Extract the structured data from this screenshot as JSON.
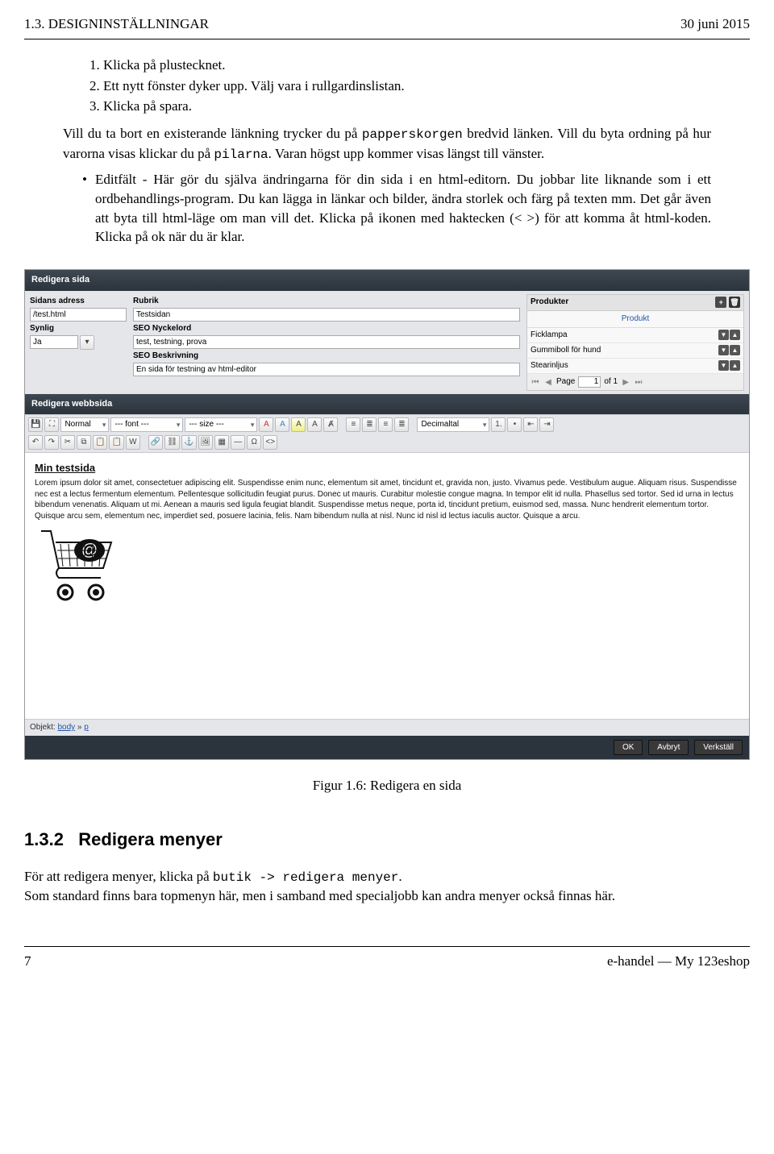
{
  "header": {
    "left": "1.3. DESIGNINSTÄLLNINGAR",
    "right": "30 juni 2015"
  },
  "steps": {
    "s1": "Klicka på plustecknet.",
    "s2": "Ett nytt fönster dyker upp. Välj vara i rullgardinslistan.",
    "s3": "Klicka på spara."
  },
  "para1": {
    "t1": "Vill du ta bort en existerande länkning trycker du på ",
    "mono1": "papperskorgen",
    "t2": " bredvid länken. Vill du byta ordning på hur varorna visas klickar du på ",
    "mono2": "pilarna",
    "t3": ". Varan högst upp kommer visas längst till vänster."
  },
  "para2": "Editfält - Här gör du själva ändringarna för din sida i en html-editorn. Du jobbar lite liknande som i ett ordbehandlings-program. Du kan lägga in länkar och bilder, ändra storlek och färg på texten mm. Det går även att byta till html-läge om man vill det. Klicka på ikonen med haktecken (< >) för att komma åt html-koden. Klicka på ok när du är klar.",
  "app": {
    "title1": "Redigera sida",
    "title2": "Redigera webbsida",
    "labels": {
      "sidans_adress": "Sidans adress",
      "synlig": "Synlig",
      "rubrik": "Rubrik",
      "seo_nyckelord": "SEO Nyckelord",
      "seo_beskrivning": "SEO Beskrivning",
      "produkter": "Produkter"
    },
    "values": {
      "adress": "/test.html",
      "synlig": "Ja",
      "rubrik": "Testsidan",
      "nyckelord": "test, testning, prova",
      "beskrivning": "En sida för testning av html-editor"
    },
    "products": {
      "link": "Produkt",
      "rows": [
        "Ficklampa",
        "Gummiboll för hund",
        "Stearinljus"
      ],
      "pager": {
        "page_label": "Page",
        "page_value": "1",
        "of": "of 1"
      }
    },
    "toolbar": {
      "normal": "Normal",
      "font": "--- font ---",
      "size": "--- size ---",
      "decimal": "Decimaltal"
    },
    "editor": {
      "heading": "Min testsida",
      "body": "Lorem ipsum dolor sit amet, consectetuer adipiscing elit. Suspendisse enim nunc, elementum sit amet, tincidunt et, gravida non, justo. Vivamus pede. Vestibulum augue. Aliquam risus. Suspendisse nec est a lectus fermentum elementum. Pellentesque sollicitudin feugiat purus. Donec ut mauris. Curabitur molestie congue magna. In tempor elit id nulla. Phasellus sed tortor. Sed id urna in lectus bibendum venenatis. Aliquam ut mi. Aenean a mauris sed ligula feugiat blandit. Suspendisse metus neque, porta id, tincidunt pretium, euismod sed, massa. Nunc hendrerit elementum tortor. Quisque arcu sem, elementum nec, imperdiet sed, posuere lacinia, felis. Nam bibendum nulla at nisl. Nunc id nisl id lectus iaculis auctor. Quisque a arcu."
    },
    "status": {
      "label": "Objekt:",
      "a": "body",
      "b": "p"
    },
    "buttons": {
      "ok": "OK",
      "cancel": "Avbryt",
      "apply": "Verkställ"
    }
  },
  "caption": "Figur 1.6: Redigera en sida",
  "section": {
    "num": "1.3.2",
    "title": "Redigera menyer"
  },
  "sectiontext": {
    "p1a": "För att redigera menyer, klicka på ",
    "mono1": "butik",
    "arrow": " -> ",
    "mono2": "redigera menyer",
    "p1b": ".",
    "p2": "Som standard finns bara topmenyn här, men i samband med specialjobb kan andra menyer också finnas här."
  },
  "footer": {
    "left": "7",
    "right": "e-handel — My 123eshop"
  }
}
